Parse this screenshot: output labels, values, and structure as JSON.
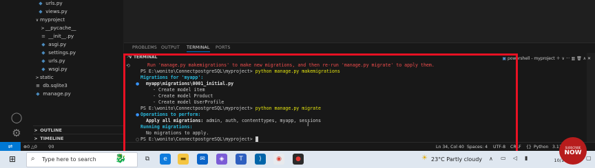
{
  "explorer": {
    "rows": [
      {
        "label": "urls.py",
        "type": "py"
      },
      {
        "label": "views.py",
        "type": "py"
      },
      {
        "label": "myproject",
        "type": "folder"
      },
      {
        "label": "__pycache__",
        "type": "folder-closed"
      },
      {
        "label": "__init__.py",
        "type": "init"
      },
      {
        "label": "asgi.py",
        "type": "py"
      },
      {
        "label": "settings.py",
        "type": "py"
      },
      {
        "label": "urls.py",
        "type": "py"
      },
      {
        "label": "wsgi.py",
        "type": "py"
      },
      {
        "label": "static",
        "type": "folder-closed"
      },
      {
        "label": "db.sqlite3",
        "type": "db"
      },
      {
        "label": "manage.py",
        "type": "py"
      }
    ],
    "outline_label": "OUTLINE",
    "timeline_label": "TIMELINE"
  },
  "panel": {
    "tabs": [
      "PROBLEMS",
      "OUTPUT",
      "TERMINAL",
      "PORTS"
    ],
    "terminal_header": "TERMINAL",
    "shell_label": "powershell - myproject"
  },
  "terminal": {
    "warning": "Run 'manage.py makemigrations' to make new migrations, and then re-run 'manage.py migrate' to apply them.",
    "prompt1": "PS E:\\wonito\\ConnectpostgreSQL\\myproject>",
    "cmd1": "python manage.py makemigrations",
    "migrations_for": "Migrations for 'myapp':",
    "migration_file": "myapp\\migrations\\0001_initial.py",
    "create_item": "- Create model item",
    "create_product": "- Create model Product",
    "create_profile": "- Create model UserProfile",
    "prompt2": "PS E:\\wonito\\ConnectpostgreSQL\\myproject>",
    "cmd2": "python manage.py migrate",
    "ops_header": "Operations to perform:",
    "apply_label": "Apply all migrations:",
    "apply_list": "admin, auth, contenttypes, myapp, sessions",
    "running": "Running migrations:",
    "no_migrations": "No migrations to apply.",
    "prompt3": "PS E:\\wonito\\ConnectpostgreSQL\\myproject>"
  },
  "status": {
    "errors": "0",
    "warnings": "0",
    "ports": "0",
    "position": "Ln 34, Col 40",
    "spaces": "Spaces: 4",
    "encoding": "UTF-8",
    "eol": "CRLF",
    "language": "Python",
    "version": "3.11"
  },
  "taskbar": {
    "search_placeholder": "Type here to search",
    "weather": "23°C  Partly cloudy",
    "time": "8:22 PM",
    "date": "10/16/2023"
  },
  "overlay": {
    "subscribe_top": "SUBSCRIBE",
    "subscribe_now": "NOW"
  }
}
